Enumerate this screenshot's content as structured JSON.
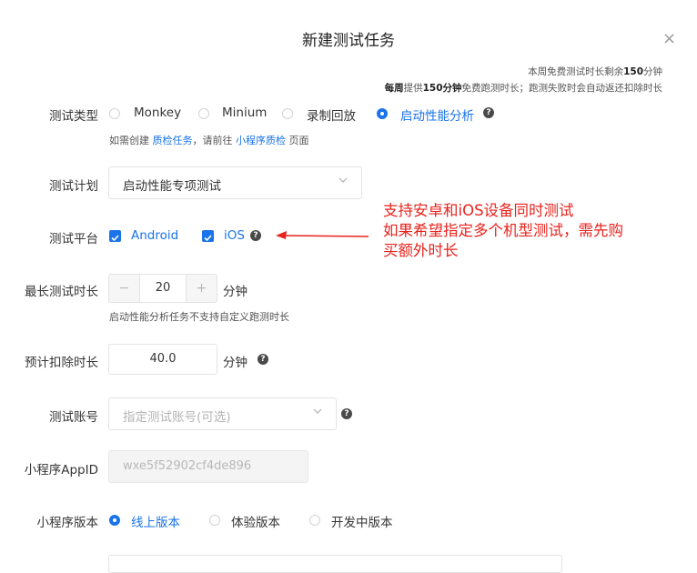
{
  "dialog": {
    "title": "新建测试任务",
    "close_symbol": "×",
    "info_line1": {
      "prefix": "本周免费测试时长剩余",
      "num": "150",
      "suffix": "分钟"
    },
    "info_line2": {
      "bold1": "每周",
      "t1": "提供",
      "bold2": "150分钟",
      "t2": "免费跑测时长；跑测失败时会自动返还扣除时长"
    }
  },
  "test_type": {
    "label": "测试类型",
    "options": [
      "Monkey",
      "Minium",
      "录制回放",
      "启动性能分析"
    ],
    "selected": "启动性能分析",
    "hint": {
      "t1": "如需创建 ",
      "link1": "质检任务",
      "t2": "，请前往 ",
      "link2": "小程序质检",
      "t3": " 页面"
    }
  },
  "test_plan": {
    "label": "测试计划",
    "value": "启动性能专项测试"
  },
  "platform": {
    "label": "测试平台",
    "options": [
      "Android",
      "iOS"
    ]
  },
  "max_duration": {
    "label": "最长测试时长",
    "value": "20",
    "minus": "−",
    "plus": "+",
    "unit": "分钟",
    "hint": "启动性能分析任务不支持自定义跑测时长"
  },
  "deduct": {
    "label": "预计扣除时长",
    "value": "40.0",
    "unit": "分钟"
  },
  "account": {
    "label": "测试账号",
    "placeholder": "指定测试账号(可选)"
  },
  "appid": {
    "label": "小程序AppID",
    "value": "wxe5f52902cf4de896"
  },
  "version": {
    "label": "小程序版本",
    "options": [
      "线上版本",
      "体验版本",
      "开发中版本"
    ],
    "selected": "线上版本"
  },
  "annotation": {
    "lines": [
      "支持安卓和iOS设备同时测试",
      "如果希望指定多个机型测试，需先购",
      "买额外时长"
    ],
    "color": "#e8231e"
  },
  "colors": {
    "accent": "#1a73e8"
  },
  "help_glyph": "?"
}
